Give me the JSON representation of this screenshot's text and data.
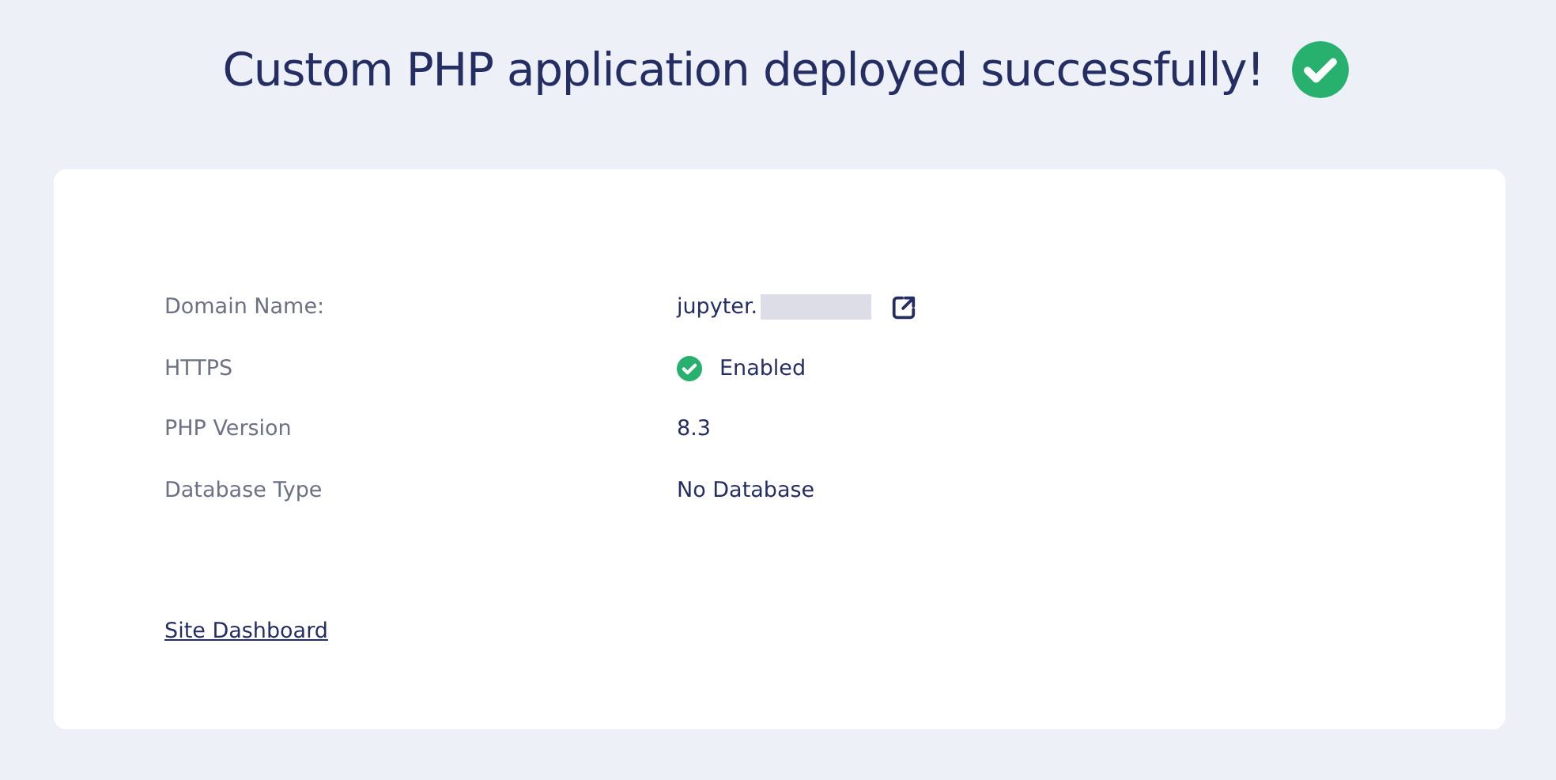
{
  "heading": {
    "title": "Custom PHP application deployed successfully!",
    "success": true
  },
  "details": [
    {
      "label": "Domain Name:",
      "kind": "domain",
      "value": "jupyter.",
      "redacted": true
    },
    {
      "label": "HTTPS",
      "kind": "status",
      "value": "Enabled",
      "on": true
    },
    {
      "label": "PHP Version",
      "kind": "text",
      "value": "8.3"
    },
    {
      "label": "Database Type",
      "kind": "text",
      "value": "No Database"
    }
  ],
  "link": "Site Dashboard"
}
